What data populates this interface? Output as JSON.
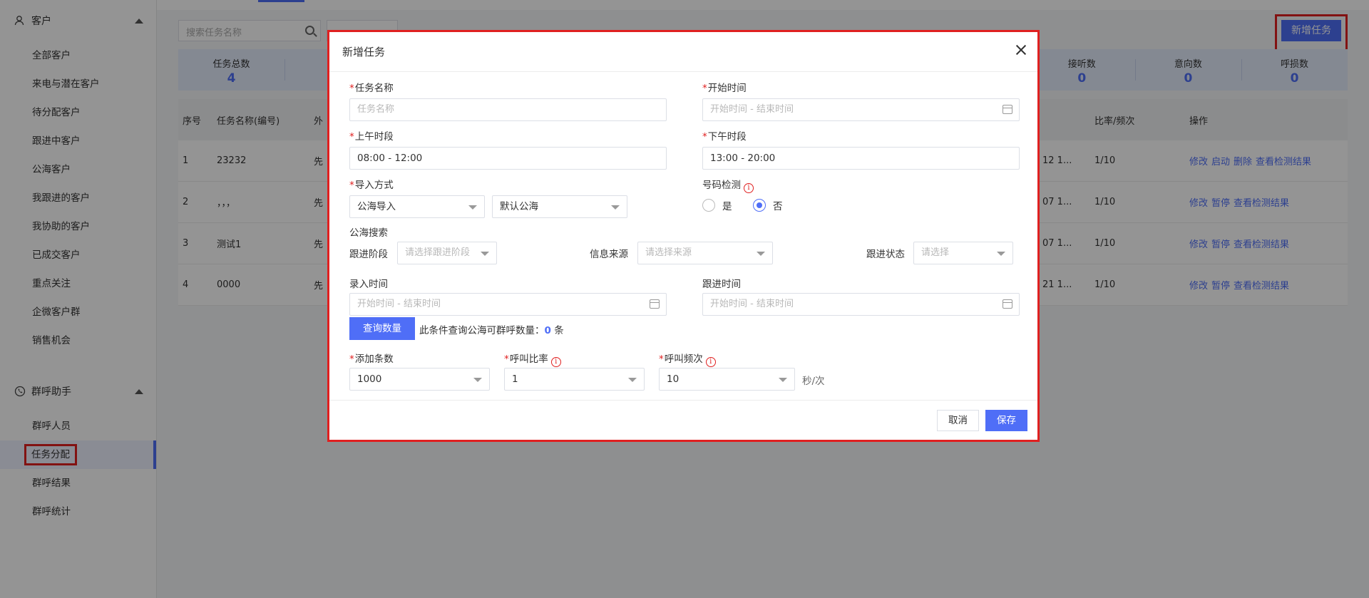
{
  "sidebar": {
    "group_customer": "客户",
    "customer_items": [
      "全部客户",
      "来电与潜在客户",
      "待分配客户",
      "跟进中客户",
      "公海客户",
      "我跟进的客户",
      "我协助的客户",
      "已成交客户",
      "重点关注",
      "企微客户群",
      "销售机会"
    ],
    "group_call": "群呼助手",
    "call_items": [
      "群呼人员",
      "任务分配",
      "群呼结果",
      "群呼统计"
    ],
    "active_item": "任务分配"
  },
  "toolbar": {
    "search_placeholder": "搜索任务名称",
    "new_task_label": "新增任务"
  },
  "stats": [
    {
      "label": "任务总数",
      "value": "4"
    },
    {
      "label": "",
      "value": ""
    },
    {
      "label": "",
      "value": ""
    },
    {
      "label": "",
      "value": ""
    },
    {
      "label": "",
      "value": ""
    },
    {
      "label": "",
      "value": ""
    },
    {
      "label": "",
      "value": ""
    },
    {
      "label": "",
      "value": ""
    },
    {
      "label": "接听数",
      "value": "0"
    },
    {
      "label": "意向数",
      "value": "0"
    },
    {
      "label": "呼损数",
      "value": "0"
    }
  ],
  "table": {
    "headers": {
      "idx": "序号",
      "name": "任务名称(编号)",
      "out": "外",
      "rate": "比率/频次",
      "ops": "操作"
    },
    "rows": [
      {
        "idx": "1",
        "name": "23232",
        "out": "先",
        "time": "12 1...",
        "rate": "1/10",
        "ops": [
          "修改",
          "启动",
          "删除",
          "查看检测结果"
        ]
      },
      {
        "idx": "2",
        "name": "，，，",
        "out": "先",
        "time": "07 1...",
        "rate": "1/10",
        "ops": [
          "修改",
          "暂停",
          "查看检测结果"
        ]
      },
      {
        "idx": "3",
        "name": "测试1",
        "out": "先",
        "time": "07 1...",
        "rate": "1/10",
        "ops": [
          "修改",
          "暂停",
          "查看检测结果"
        ]
      },
      {
        "idx": "4",
        "name": "0000",
        "out": "先",
        "time": "21 1...",
        "rate": "1/10",
        "ops": [
          "修改",
          "暂停",
          "查看检测结果"
        ]
      }
    ]
  },
  "modal": {
    "title": "新增任务",
    "task_name": {
      "label": "任务名称",
      "placeholder": "任务名称"
    },
    "start_time": {
      "label": "开始时间",
      "placeholder": "开始时间 - 结束时间"
    },
    "am_period": {
      "label": "上午时段",
      "value": "08:00 - 12:00"
    },
    "pm_period": {
      "label": "下午时段",
      "value": "13:00 - 20:00"
    },
    "import_mode": {
      "label": "导入方式",
      "value": "公海导入",
      "pool_value": "默认公海"
    },
    "number_check": {
      "label": "号码检测",
      "yes": "是",
      "no": "否",
      "selected": "否"
    },
    "pool_search_title": "公海搜索",
    "follow_stage": {
      "label": "跟进阶段",
      "placeholder": "请选择跟进阶段"
    },
    "info_source": {
      "label": "信息来源",
      "placeholder": "请选择来源"
    },
    "follow_status": {
      "label": "跟进状态",
      "placeholder": "请选择"
    },
    "entry_time": {
      "label": "录入时间",
      "placeholder": "开始时间 - 结束时间"
    },
    "follow_time": {
      "label": "跟进时间",
      "placeholder": "开始时间 - 结束时间"
    },
    "query_button": "查询数量",
    "query_text_prefix": "此条件查询公海可群呼数量：",
    "query_count": "0",
    "query_text_suffix": " 条",
    "add_count": {
      "label": "添加条数",
      "value": "1000"
    },
    "call_ratio": {
      "label": "呼叫比率",
      "value": "1"
    },
    "call_freq": {
      "label": "呼叫频次",
      "value": "10",
      "unit": "秒/次"
    },
    "cancel_label": "取消",
    "save_label": "保存"
  },
  "colors": {
    "accent": "#4f6ef7",
    "highlight": "#e02020"
  }
}
